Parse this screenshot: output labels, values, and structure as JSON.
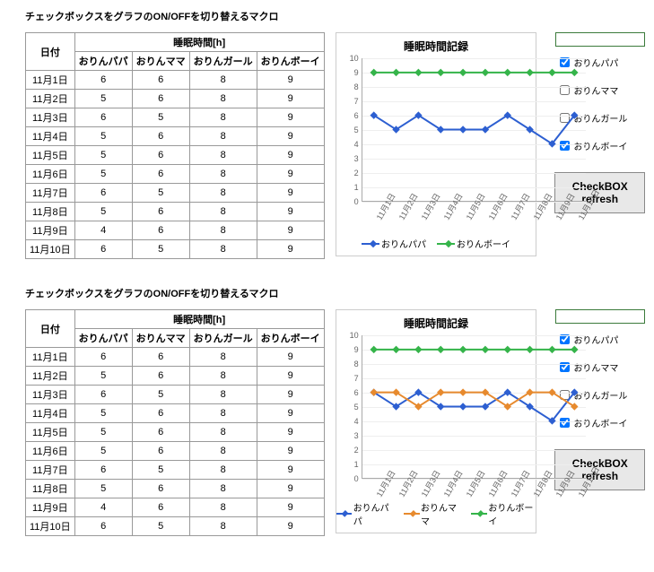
{
  "title": "チェックボックスをグラフのON/OFFを切り替えるマクロ",
  "table": {
    "date_header": "日付",
    "group_header": "睡眠時間[h]",
    "columns": [
      "おりんパパ",
      "おりんママ",
      "おりんガール",
      "おりんボーイ"
    ],
    "rows": [
      {
        "date": "11月1日",
        "v": [
          6,
          6,
          8,
          9
        ]
      },
      {
        "date": "11月2日",
        "v": [
          5,
          6,
          8,
          9
        ]
      },
      {
        "date": "11月3日",
        "v": [
          6,
          5,
          8,
          9
        ]
      },
      {
        "date": "11月4日",
        "v": [
          5,
          6,
          8,
          9
        ]
      },
      {
        "date": "11月5日",
        "v": [
          5,
          6,
          8,
          9
        ]
      },
      {
        "date": "11月6日",
        "v": [
          5,
          6,
          8,
          9
        ]
      },
      {
        "date": "11月7日",
        "v": [
          6,
          5,
          8,
          9
        ]
      },
      {
        "date": "11月8日",
        "v": [
          5,
          6,
          8,
          9
        ]
      },
      {
        "date": "11月9日",
        "v": [
          4,
          6,
          8,
          9
        ]
      },
      {
        "date": "11月10日",
        "v": [
          6,
          5,
          8,
          9
        ]
      }
    ]
  },
  "chart_data": [
    {
      "type": "line",
      "title": "睡眠時間記録",
      "categories": [
        "11月1日",
        "11月2日",
        "11月3日",
        "11月4日",
        "11月5日",
        "11月6日",
        "11月7日",
        "11月8日",
        "11月9日",
        "11月10日"
      ],
      "ylim": [
        0,
        10
      ],
      "yticks": [
        0,
        1,
        2,
        3,
        4,
        5,
        6,
        7,
        8,
        9,
        10
      ],
      "series": [
        {
          "name": "おりんパパ",
          "color": "#2d5fd1",
          "values": [
            6,
            5,
            6,
            5,
            5,
            5,
            6,
            5,
            4,
            6
          ]
        },
        {
          "name": "おりんボーイ",
          "color": "#35b44a",
          "values": [
            9,
            9,
            9,
            9,
            9,
            9,
            9,
            9,
            9,
            9
          ]
        }
      ],
      "legend": [
        "おりんパパ",
        "おりんボーイ"
      ]
    },
    {
      "type": "line",
      "title": "睡眠時間記録",
      "categories": [
        "11月1日",
        "11月2日",
        "11月3日",
        "11月4日",
        "11月5日",
        "11月6日",
        "11月7日",
        "11月8日",
        "11月9日",
        "11月10日"
      ],
      "ylim": [
        0,
        10
      ],
      "yticks": [
        0,
        1,
        2,
        3,
        4,
        5,
        6,
        7,
        8,
        9,
        10
      ],
      "series": [
        {
          "name": "おりんパパ",
          "color": "#2d5fd1",
          "values": [
            6,
            5,
            6,
            5,
            5,
            5,
            6,
            5,
            4,
            6
          ]
        },
        {
          "name": "おりんママ",
          "color": "#e78a2e",
          "values": [
            6,
            6,
            5,
            6,
            6,
            6,
            5,
            6,
            6,
            5
          ]
        },
        {
          "name": "おりんボーイ",
          "color": "#35b44a",
          "values": [
            9,
            9,
            9,
            9,
            9,
            9,
            9,
            9,
            9,
            9
          ]
        }
      ],
      "legend": [
        "おりんパパ",
        "おりんママ",
        "おりんボーイ"
      ]
    }
  ],
  "checkboxes": {
    "labels": [
      "おりんパパ",
      "おりんママ",
      "おりんガール",
      "おりんボーイ"
    ],
    "section1": [
      true,
      false,
      false,
      true
    ],
    "section2": [
      true,
      true,
      false,
      true
    ]
  },
  "button_label": "CheckBOX refresh"
}
